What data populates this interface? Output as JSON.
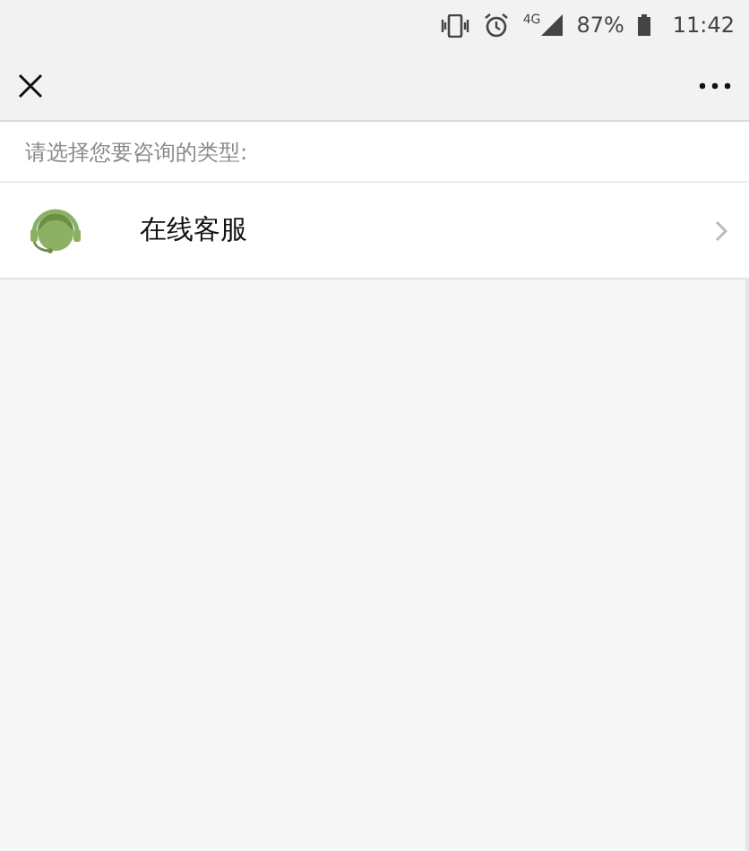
{
  "status_bar": {
    "network": "4G",
    "battery": "87%",
    "time": "11:42"
  },
  "prompt": "请选择您要咨询的类型:",
  "items": [
    {
      "label": "在线客服"
    }
  ]
}
